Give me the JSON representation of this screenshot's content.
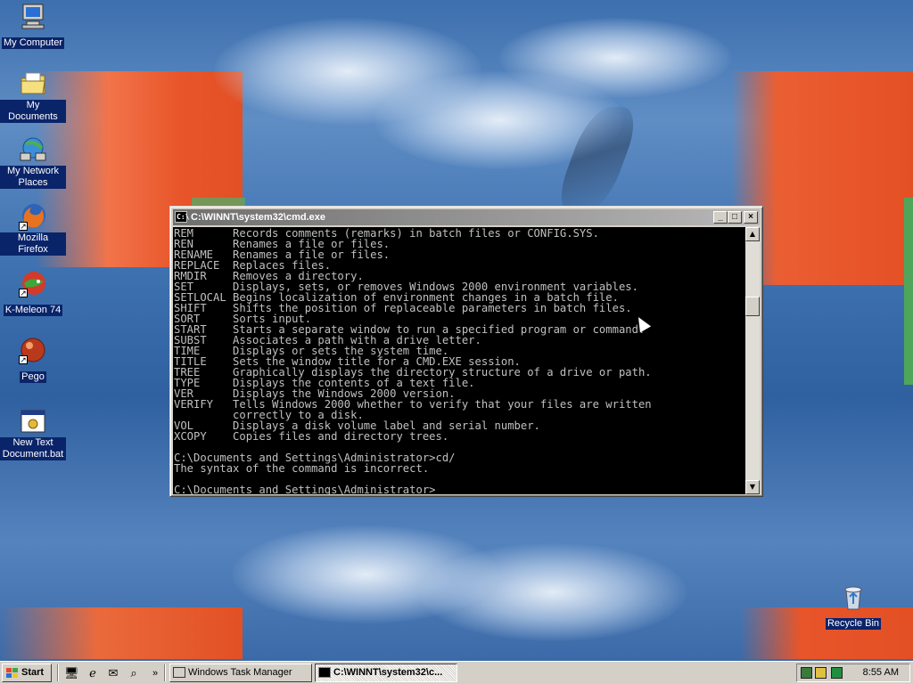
{
  "desktop": {
    "icons": [
      {
        "label": "My Computer",
        "icon": "computer-icon"
      },
      {
        "label": "My Documents",
        "icon": "folder-icon"
      },
      {
        "label": "My Network Places",
        "icon": "network-icon"
      },
      {
        "label": "Mozilla Firefox",
        "icon": "firefox-icon"
      },
      {
        "label": "K-Meleon 74",
        "icon": "kmeleon-icon"
      },
      {
        "label": "Pego",
        "icon": "pego-icon"
      },
      {
        "label": "New Text Document.bat",
        "icon": "batch-file-icon"
      },
      {
        "label": "Recycle Bin",
        "icon": "recycle-bin-icon"
      }
    ]
  },
  "cmd_window": {
    "title": "C:\\WINNT\\system32\\cmd.exe",
    "lines": [
      "REM      Records comments (remarks) in batch files or CONFIG.SYS.",
      "REN      Renames a file or files.",
      "RENAME   Renames a file or files.",
      "REPLACE  Replaces files.",
      "RMDIR    Removes a directory.",
      "SET      Displays, sets, or removes Windows 2000 environment variables.",
      "SETLOCAL Begins localization of environment changes in a batch file.",
      "SHIFT    Shifts the position of replaceable parameters in batch files.",
      "SORT     Sorts input.",
      "START    Starts a separate window to run a specified program or command.",
      "SUBST    Associates a path with a drive letter.",
      "TIME     Displays or sets the system time.",
      "TITLE    Sets the window title for a CMD.EXE session.",
      "TREE     Graphically displays the directory structure of a drive or path.",
      "TYPE     Displays the contents of a text file.",
      "VER      Displays the Windows 2000 version.",
      "VERIFY   Tells Windows 2000 whether to verify that your files are written",
      "         correctly to a disk.",
      "VOL      Displays a disk volume label and serial number.",
      "XCOPY    Copies files and directory trees.",
      "",
      "C:\\Documents and Settings\\Administrator>cd/",
      "The syntax of the command is incorrect.",
      "",
      "C:\\Documents and Settings\\Administrator>"
    ]
  },
  "taskbar": {
    "start_label": "Start",
    "quick_launch_more": "»",
    "tasks": [
      {
        "label": "Windows Task Manager",
        "active": false
      },
      {
        "label": "C:\\WINNT\\system32\\c...",
        "active": true
      }
    ],
    "clock": "8:55 AM"
  }
}
